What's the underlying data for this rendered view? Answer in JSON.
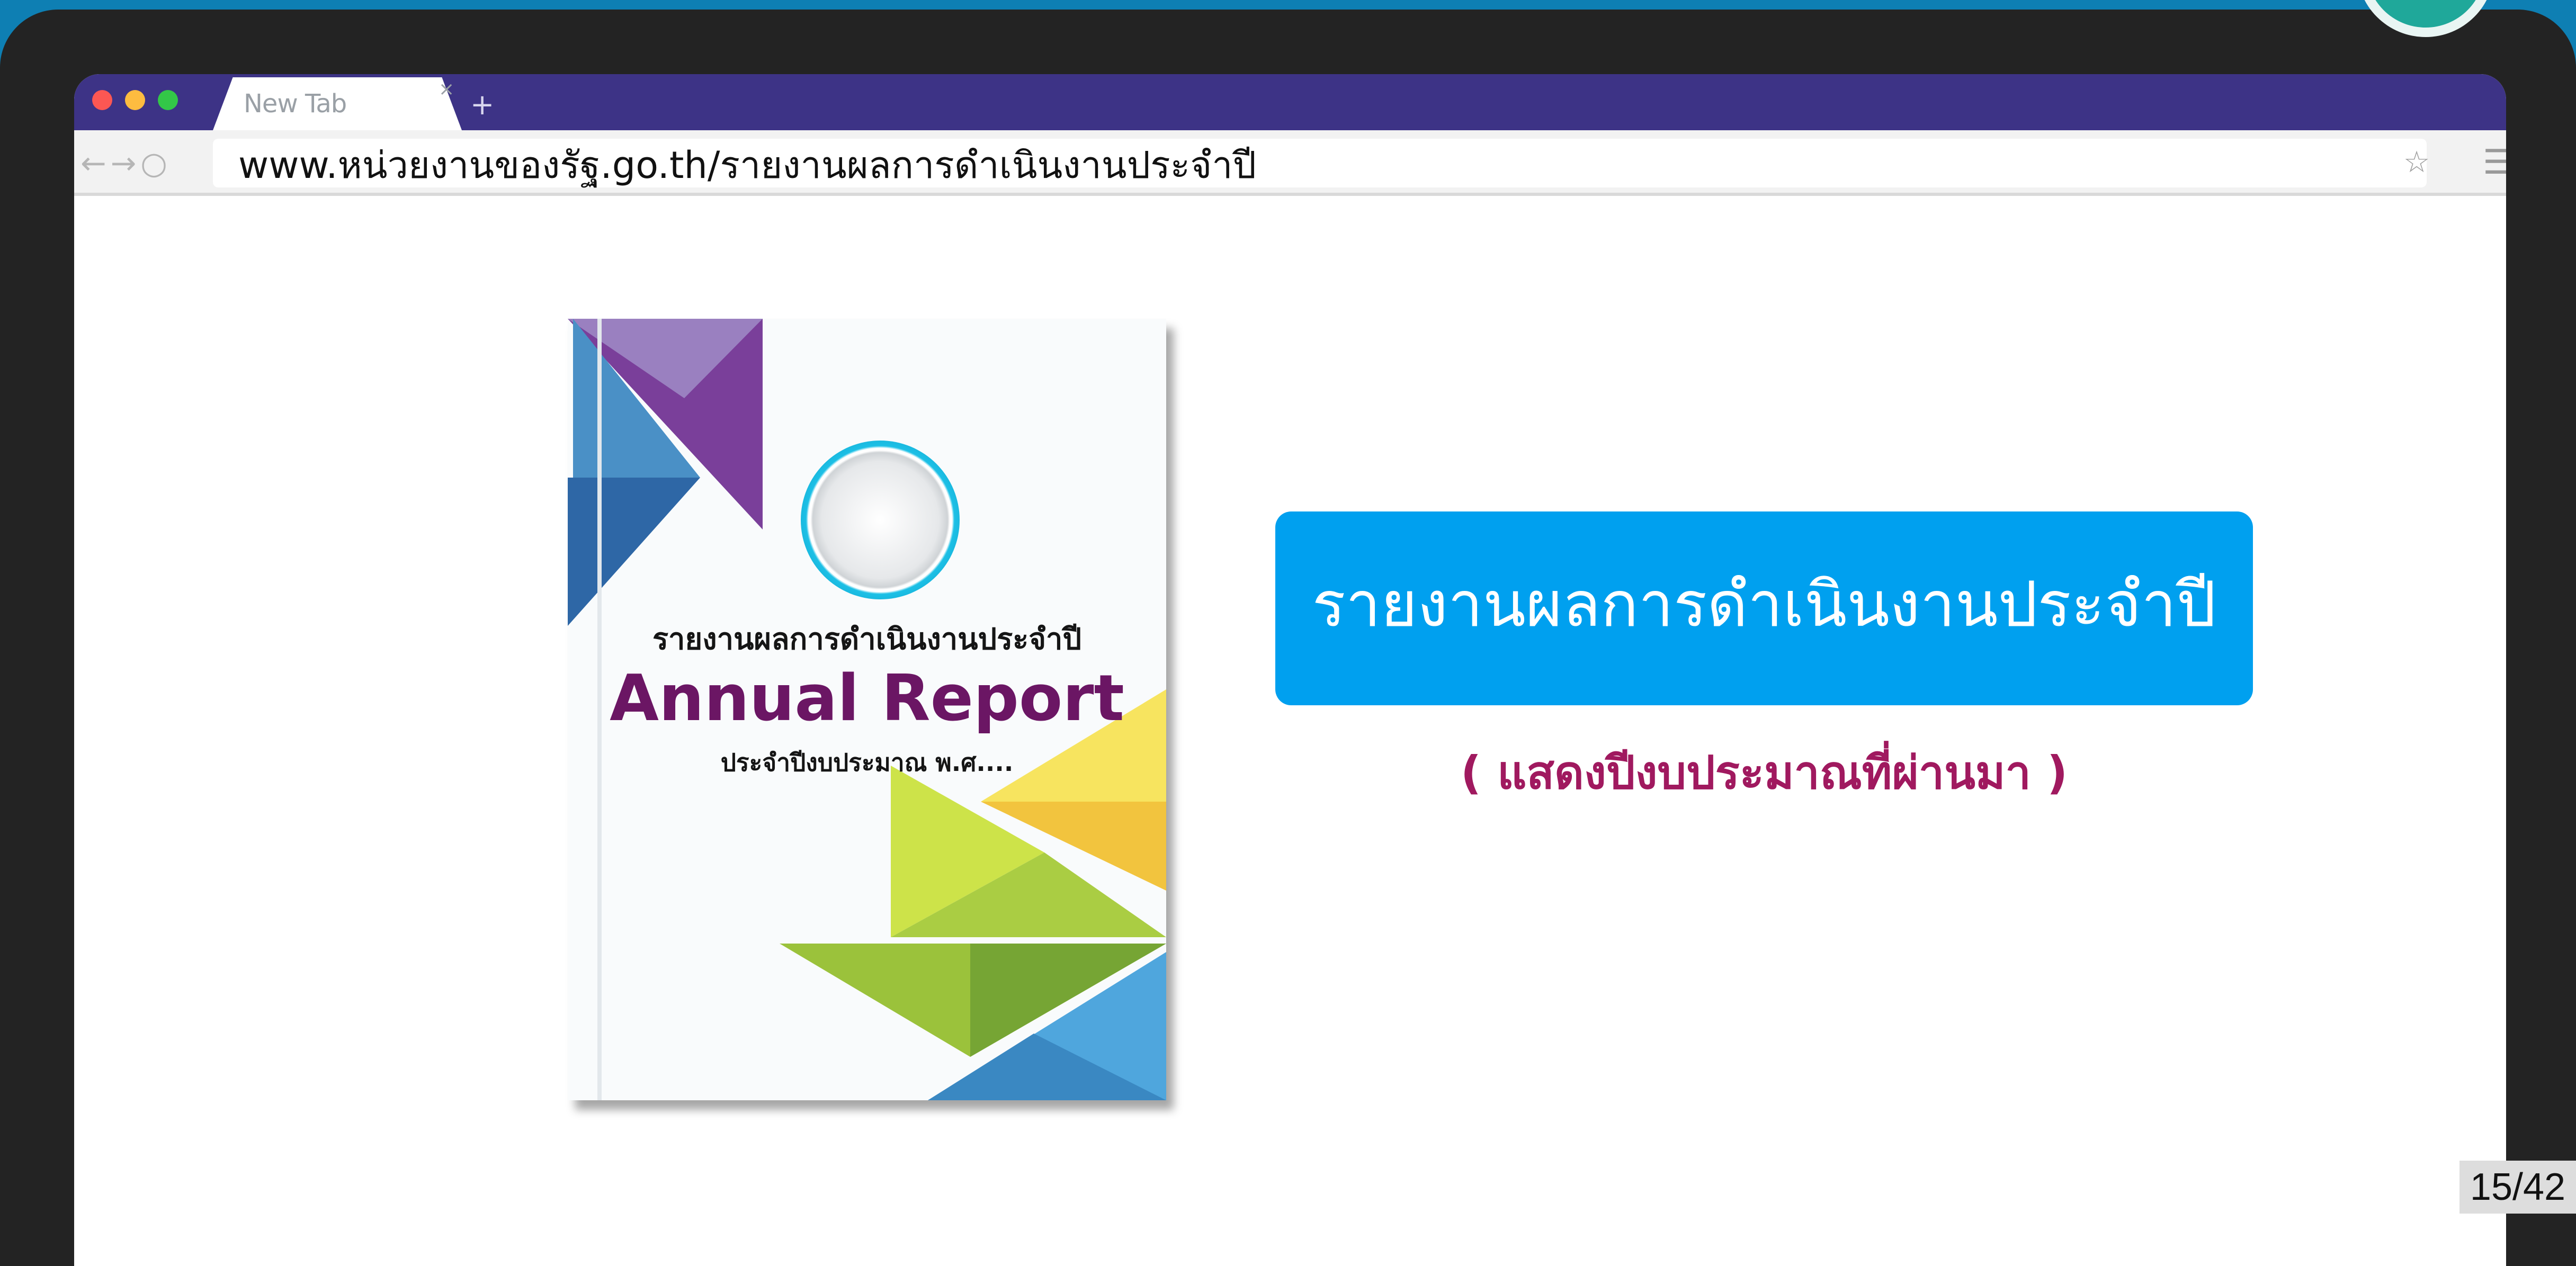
{
  "browser": {
    "tab_label": "New Tab",
    "tab_close": "×",
    "new_tab": "+",
    "nav_icons": "←→○",
    "address_bar": "www.หน่วยงานของรัฐ.go.th/รายงานผลการดำเนินงานประจำปี",
    "star_icon": "☆",
    "menu_icon": "☰",
    "traffic_lights": {
      "close": "#fc5753",
      "minimize": "#fdbc40",
      "maximize": "#33c748"
    },
    "tabbar_color": "#3d3386"
  },
  "cover": {
    "thai_title": "รายงานผลการดำเนินงานประจำปี",
    "english_title": "Annual Report",
    "subtitle": "ประจำปีงบประมาณ พ.ศ...."
  },
  "content": {
    "title": "รายงานผลการดำเนินงานประจำปี",
    "subtitle": "( แสดงปีงบประมาณที่ผ่านมา )",
    "title_bg_color": "#00a0ef",
    "subtitle_color": "#a0195f"
  },
  "slide": {
    "page_counter": "15/42"
  }
}
